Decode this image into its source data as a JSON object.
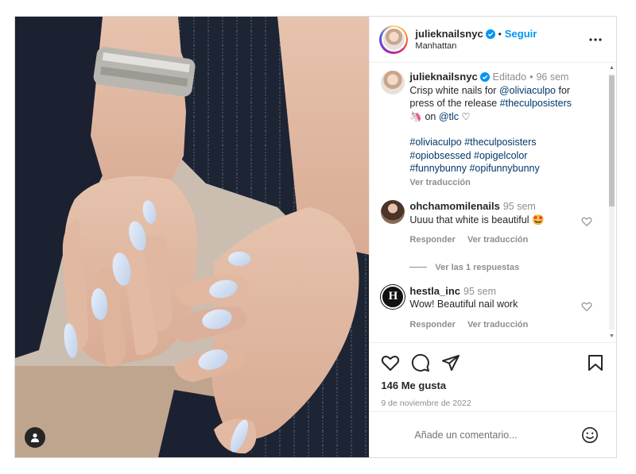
{
  "post": {
    "author": "julieknailsnyc",
    "follow_label": "Seguir",
    "location": "Manhattan",
    "more_icon": "more-horizontal-icon",
    "colors": {
      "accent": "#0095f6",
      "link": "#00376b",
      "muted": "#8e8e8e"
    }
  },
  "caption": {
    "author": "julieknailsnyc",
    "edited": "Editado",
    "age": "96 sem",
    "text_prefix": "Crisp white nails for ",
    "mention1": "@oliviaculpo",
    "text_mid": " for press of the release ",
    "hashtag1": "#theculposisters",
    "text_on": " on ",
    "mention2": "@tlc",
    "emoji_unicorn": "🦄",
    "emoji_heart": "♡",
    "hashtags_line1": "#oliviaculpo #theculposisters",
    "hashtags_line2": "#opiobsessed #opigelcolor",
    "hashtags_line3": "#funnybunny #opifunnybunny",
    "translate": "Ver traducción"
  },
  "comments": [
    {
      "author": "ohchamomilenails",
      "age": "95 sem",
      "text": "Uuuu that white is beautiful 🤩",
      "reply": "Responder",
      "translate": "Ver traducción",
      "view_replies": "Ver las 1 respuestas"
    },
    {
      "author": "hestla_inc",
      "age": "95 sem",
      "text": "Wow! Beautiful nail work",
      "reply": "Responder",
      "translate": "Ver traducción",
      "avatar_letter": "H"
    }
  ],
  "footer": {
    "likes": "146 Me gusta",
    "date": "9 de noviembre de 2022",
    "comment_placeholder": "Añade un comentario..."
  }
}
